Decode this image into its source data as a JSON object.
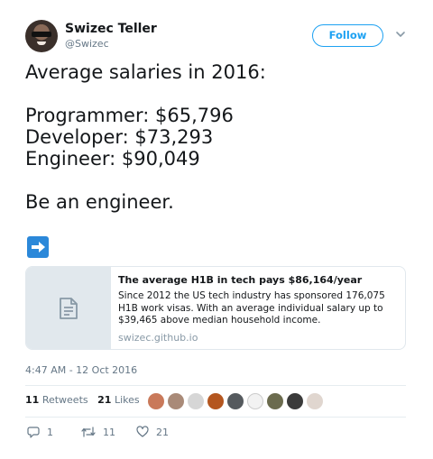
{
  "author": {
    "name": "Swizec Teller",
    "handle": "@Swizec",
    "follow_label": "Follow"
  },
  "tweet": {
    "line1": "Average salaries in 2016:",
    "line2": "Programmer: $65,796",
    "line3": "Developer: $73,293",
    "line4": "Engineer: $90,049",
    "line5": "Be an engineer.",
    "emoji": "right-arrow-emoji"
  },
  "card": {
    "title": "The average H1B in tech pays $86,164/year",
    "description": "Since 2012 the US tech industry has sponsored 176,075 H1B work visas. With an average individual salary up to $39,465 above median household income.",
    "domain": "swizec.github.io",
    "thumb_icon": "document-icon"
  },
  "timestamp": "4:47 AM - 12 Oct 2016",
  "stats": {
    "retweets_count": "11",
    "retweets_label": "Retweets",
    "likes_count": "21",
    "likes_label": "Likes"
  },
  "actions": {
    "reply_count": "1",
    "retweet_count": "11",
    "like_count": "21"
  },
  "colors": {
    "accent": "#1da1f2",
    "muted": "#657786",
    "emoji_blue": "#2b88d9"
  }
}
